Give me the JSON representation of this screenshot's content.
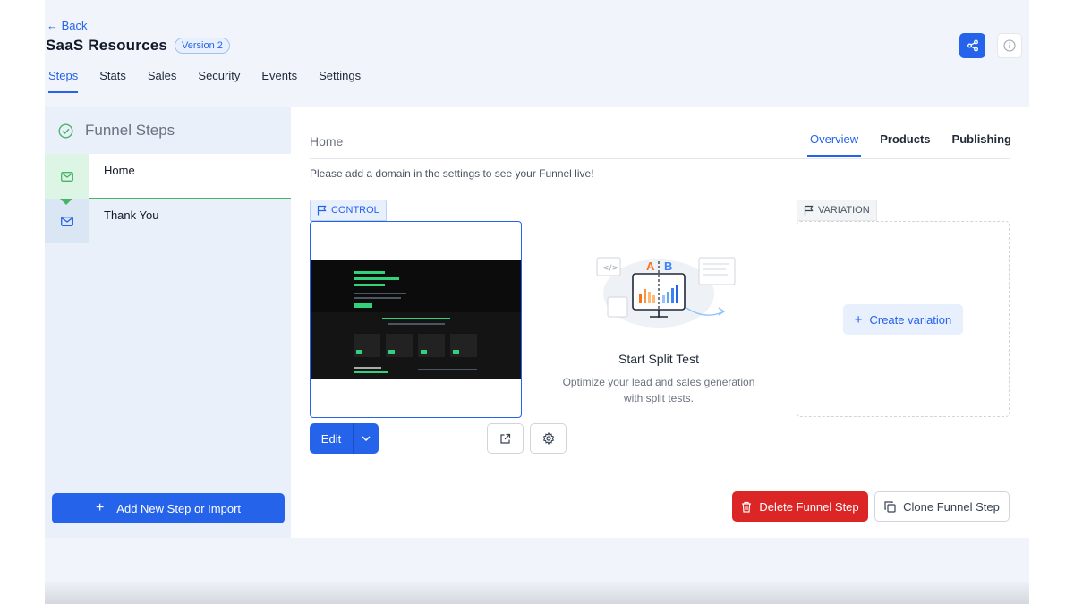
{
  "header": {
    "back_label": "Back",
    "title": "SaaS Resources",
    "version_badge": "Version 2"
  },
  "tabs": [
    "Steps",
    "Stats",
    "Sales",
    "Security",
    "Events",
    "Settings"
  ],
  "active_tab": "Steps",
  "sidebar": {
    "title": "Funnel Steps",
    "steps": [
      {
        "label": "Home",
        "active": true
      },
      {
        "label": "Thank You",
        "active": false
      }
    ],
    "add_button": "Add New Step or Import"
  },
  "main": {
    "title": "Home",
    "tabs": [
      "Overview",
      "Products",
      "Publishing"
    ],
    "active_tab": "Overview",
    "notice": "Please add a domain in the settings to see your Funnel live!",
    "control_label": "CONTROL",
    "variation_label": "VARIATION",
    "edit_label": "Edit",
    "split": {
      "title": "Start Split Test",
      "description": "Optimize your lead and sales generation with split tests.",
      "letter_a": "A",
      "letter_b": "B"
    },
    "create_variation": "Create variation",
    "delete_button": "Delete Funnel Step",
    "clone_button": "Clone Funnel Step"
  },
  "colors": {
    "primary": "#2563eb",
    "success": "#4ab36b",
    "danger": "#dc2626",
    "background": "#f1f5fb"
  },
  "icons": {
    "share": "share-icon",
    "info": "info-icon",
    "check": "check-circle-icon",
    "step": "envelope-icon",
    "plus": "plus-icon",
    "flag": "flag-icon",
    "chevron": "chevron-down-icon",
    "external": "external-link-icon",
    "settings": "gear-icon",
    "trash": "trash-icon",
    "copy": "copy-icon"
  }
}
